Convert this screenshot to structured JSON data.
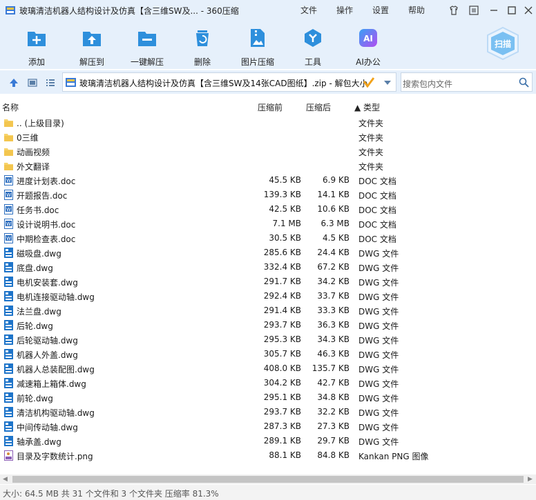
{
  "window": {
    "title": "玻璃清洁机器人结构设计及仿真【含三维SW及... - 360压缩",
    "menu": [
      "文件",
      "操作",
      "设置",
      "帮助"
    ]
  },
  "toolbar": {
    "items": [
      {
        "label": "添加",
        "icon": "add-icon"
      },
      {
        "label": "解压到",
        "icon": "extract-to-icon"
      },
      {
        "label": "一键解压",
        "icon": "one-click-extract-icon"
      },
      {
        "label": "删除",
        "icon": "delete-icon"
      },
      {
        "label": "图片压缩",
        "icon": "image-compress-icon"
      },
      {
        "label": "工具",
        "icon": "tools-icon"
      },
      {
        "label": "AI办公",
        "icon": "ai-office-icon"
      }
    ],
    "ai_badge": "AI",
    "scan_label": "扫描"
  },
  "address": {
    "path": "玻璃清洁机器人结构设计及仿真【含三维SW及14张CAD图纸】.zip - 解包大小",
    "search_placeholder": "搜索包内文件"
  },
  "columns": {
    "name": "名称",
    "original": "压缩前",
    "compressed": "压缩后",
    "type": "▲ 类型"
  },
  "files": [
    {
      "name": ".. (上级目录)",
      "orig": "",
      "comp": "",
      "type": "文件夹",
      "kind": "folder"
    },
    {
      "name": "0三维",
      "orig": "",
      "comp": "",
      "type": "文件夹",
      "kind": "folder"
    },
    {
      "name": "动画视频",
      "orig": "",
      "comp": "",
      "type": "文件夹",
      "kind": "folder"
    },
    {
      "name": "外文翻译",
      "orig": "",
      "comp": "",
      "type": "文件夹",
      "kind": "folder"
    },
    {
      "name": "进度计划表.doc",
      "orig": "45.5 KB",
      "comp": "6.9 KB",
      "type": "DOC 文档",
      "kind": "doc"
    },
    {
      "name": "开题报告.doc",
      "orig": "139.3 KB",
      "comp": "14.1 KB",
      "type": "DOC 文档",
      "kind": "doc"
    },
    {
      "name": "任务书.doc",
      "orig": "42.5 KB",
      "comp": "10.6 KB",
      "type": "DOC 文档",
      "kind": "doc"
    },
    {
      "name": "设计说明书.doc",
      "orig": "7.1 MB",
      "comp": "6.3 MB",
      "type": "DOC 文档",
      "kind": "doc"
    },
    {
      "name": "中期检查表.doc",
      "orig": "30.5 KB",
      "comp": "4.5 KB",
      "type": "DOC 文档",
      "kind": "doc"
    },
    {
      "name": "磁吸盘.dwg",
      "orig": "285.6 KB",
      "comp": "24.4 KB",
      "type": "DWG 文件",
      "kind": "dwg"
    },
    {
      "name": "底盘.dwg",
      "orig": "332.4 KB",
      "comp": "67.2 KB",
      "type": "DWG 文件",
      "kind": "dwg"
    },
    {
      "name": "电机安装套.dwg",
      "orig": "291.7 KB",
      "comp": "34.2 KB",
      "type": "DWG 文件",
      "kind": "dwg"
    },
    {
      "name": "电机连接驱动轴.dwg",
      "orig": "292.4 KB",
      "comp": "33.7 KB",
      "type": "DWG 文件",
      "kind": "dwg"
    },
    {
      "name": "法兰盘.dwg",
      "orig": "291.4 KB",
      "comp": "33.3 KB",
      "type": "DWG 文件",
      "kind": "dwg"
    },
    {
      "name": "后轮.dwg",
      "orig": "293.7 KB",
      "comp": "36.3 KB",
      "type": "DWG 文件",
      "kind": "dwg"
    },
    {
      "name": "后轮驱动轴.dwg",
      "orig": "295.3 KB",
      "comp": "34.3 KB",
      "type": "DWG 文件",
      "kind": "dwg"
    },
    {
      "name": "机器人外盖.dwg",
      "orig": "305.7 KB",
      "comp": "46.3 KB",
      "type": "DWG 文件",
      "kind": "dwg"
    },
    {
      "name": "机器人总装配图.dwg",
      "orig": "408.0 KB",
      "comp": "135.7 KB",
      "type": "DWG 文件",
      "kind": "dwg"
    },
    {
      "name": "减速箱上箱体.dwg",
      "orig": "304.2 KB",
      "comp": "42.7 KB",
      "type": "DWG 文件",
      "kind": "dwg"
    },
    {
      "name": "前轮.dwg",
      "orig": "295.1 KB",
      "comp": "34.8 KB",
      "type": "DWG 文件",
      "kind": "dwg"
    },
    {
      "name": "清洁机构驱动轴.dwg",
      "orig": "293.7 KB",
      "comp": "32.2 KB",
      "type": "DWG 文件",
      "kind": "dwg"
    },
    {
      "name": "中间传动轴.dwg",
      "orig": "287.3 KB",
      "comp": "27.3 KB",
      "type": "DWG 文件",
      "kind": "dwg"
    },
    {
      "name": "轴承盖.dwg",
      "orig": "289.1 KB",
      "comp": "29.7 KB",
      "type": "DWG 文件",
      "kind": "dwg"
    },
    {
      "name": "目录及字数统计.png",
      "orig": "88.1 KB",
      "comp": "84.8 KB",
      "type": "Kankan PNG 图像",
      "kind": "png"
    }
  ],
  "status": "大小: 64.5 MB 共 31 个文件和 3 个文件夹 压缩率 81.3%",
  "colors": {
    "accent": "#2e8fdc",
    "chrome": "#e6f0fb",
    "folder": "#f7d36b"
  }
}
